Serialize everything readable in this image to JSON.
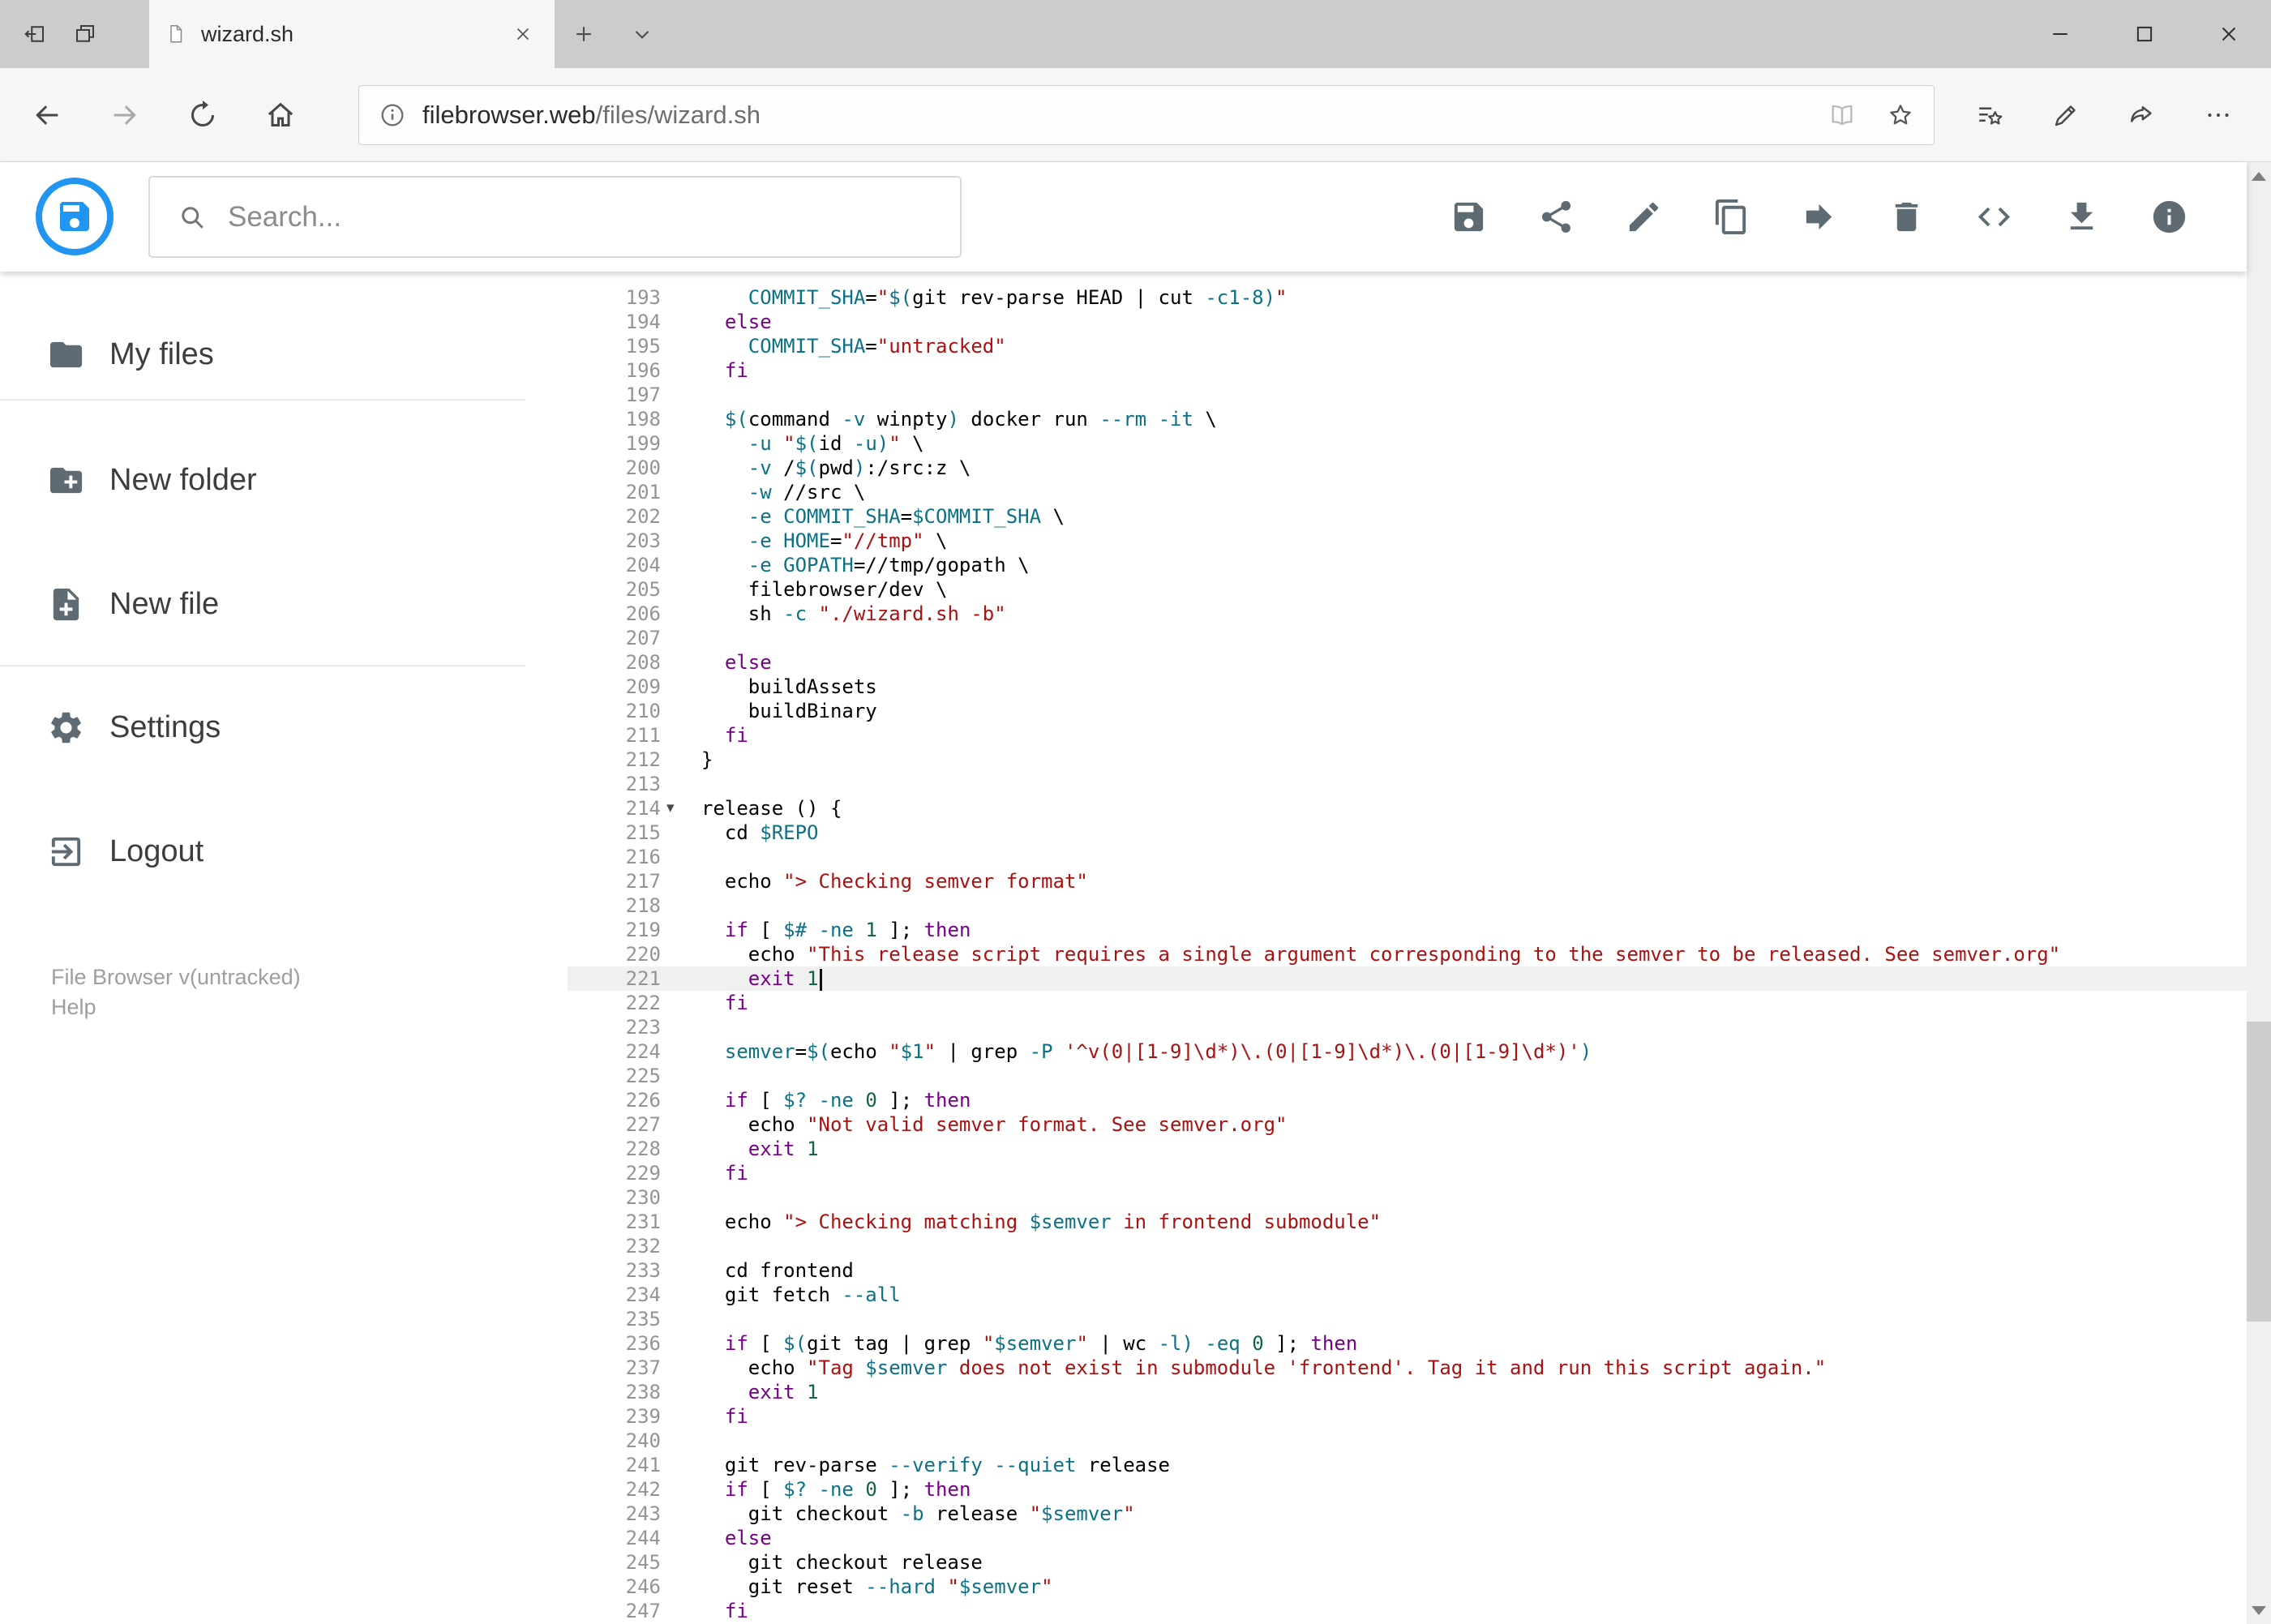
{
  "colors": {
    "accent": "#2095f2",
    "icon-gray": "#5f6b73",
    "tok-p": "#000000",
    "tok-k": "#770088",
    "tok-v": "#0b7285",
    "tok-s": "#aa1111",
    "tok-n": "#116644",
    "active-line": "#f0f0f0"
  },
  "browser": {
    "tab_title": "wizard.sh",
    "url": {
      "host": "filebrowser.web",
      "path": "/files/wizard.sh"
    }
  },
  "header": {
    "search_placeholder": "Search...",
    "toolbar": [
      {
        "name": "save",
        "icon": "save"
      },
      {
        "name": "share",
        "icon": "share"
      },
      {
        "name": "rename",
        "icon": "edit"
      },
      {
        "name": "copy",
        "icon": "copy"
      },
      {
        "name": "move",
        "icon": "move"
      },
      {
        "name": "delete",
        "icon": "delete"
      },
      {
        "name": "raw",
        "icon": "code"
      },
      {
        "name": "download",
        "icon": "download"
      },
      {
        "name": "info",
        "icon": "info"
      }
    ]
  },
  "sidebar": {
    "items": [
      {
        "label": "My files",
        "icon": "folder"
      },
      {
        "label": "New folder",
        "icon": "create-new-folder"
      },
      {
        "label": "New file",
        "icon": "note-add"
      },
      {
        "label": "Settings",
        "icon": "settings"
      },
      {
        "label": "Logout",
        "icon": "logout"
      }
    ],
    "footer": {
      "version": "File Browser v(untracked)",
      "help": "Help"
    }
  },
  "editor": {
    "active_line": 221,
    "lines": [
      {
        "n": 193,
        "segs": [
          [
            "    ",
            "p"
          ],
          [
            "COMMIT_SHA",
            "v"
          ],
          [
            "=",
            "p"
          ],
          [
            "\"",
            "s"
          ],
          [
            "$(",
            "v"
          ],
          [
            "git rev-parse HEAD | cut ",
            "p"
          ],
          [
            "-c1-8",
            "v"
          ],
          [
            ")",
            "v"
          ],
          [
            "\"",
            "s"
          ]
        ]
      },
      {
        "n": 194,
        "segs": [
          [
            "  ",
            "p"
          ],
          [
            "else",
            "k"
          ]
        ]
      },
      {
        "n": 195,
        "segs": [
          [
            "    ",
            "p"
          ],
          [
            "COMMIT_SHA",
            "v"
          ],
          [
            "=",
            "p"
          ],
          [
            "\"untracked\"",
            "s"
          ]
        ]
      },
      {
        "n": 196,
        "segs": [
          [
            "  ",
            "p"
          ],
          [
            "fi",
            "k"
          ]
        ]
      },
      {
        "n": 197,
        "segs": []
      },
      {
        "n": 198,
        "segs": [
          [
            "  ",
            "p"
          ],
          [
            "$(",
            "v"
          ],
          [
            "command ",
            "p"
          ],
          [
            "-v",
            "v"
          ],
          [
            " winpty",
            "p"
          ],
          [
            ")",
            "v"
          ],
          [
            " docker run ",
            "p"
          ],
          [
            "--rm",
            "v"
          ],
          [
            " ",
            "p"
          ],
          [
            "-it",
            "v"
          ],
          [
            " \\",
            "p"
          ]
        ]
      },
      {
        "n": 199,
        "segs": [
          [
            "    ",
            "p"
          ],
          [
            "-u",
            "v"
          ],
          [
            " ",
            "p"
          ],
          [
            "\"",
            "s"
          ],
          [
            "$(",
            "v"
          ],
          [
            "id ",
            "p"
          ],
          [
            "-u",
            "v"
          ],
          [
            ")",
            "v"
          ],
          [
            "\"",
            "s"
          ],
          [
            " \\",
            "p"
          ]
        ]
      },
      {
        "n": 200,
        "segs": [
          [
            "    ",
            "p"
          ],
          [
            "-v",
            "v"
          ],
          [
            " /",
            "p"
          ],
          [
            "$(",
            "v"
          ],
          [
            "pwd",
            "p"
          ],
          [
            ")",
            "v"
          ],
          [
            ":/src:z \\",
            "p"
          ]
        ]
      },
      {
        "n": 201,
        "segs": [
          [
            "    ",
            "p"
          ],
          [
            "-w",
            "v"
          ],
          [
            " //src \\",
            "p"
          ]
        ]
      },
      {
        "n": 202,
        "segs": [
          [
            "    ",
            "p"
          ],
          [
            "-e",
            "v"
          ],
          [
            " ",
            "p"
          ],
          [
            "COMMIT_SHA",
            "v"
          ],
          [
            "=",
            "p"
          ],
          [
            "$COMMIT_SHA",
            "v"
          ],
          [
            " \\",
            "p"
          ]
        ]
      },
      {
        "n": 203,
        "segs": [
          [
            "    ",
            "p"
          ],
          [
            "-e",
            "v"
          ],
          [
            " ",
            "p"
          ],
          [
            "HOME",
            "v"
          ],
          [
            "=",
            "p"
          ],
          [
            "\"//tmp\"",
            "s"
          ],
          [
            " \\",
            "p"
          ]
        ]
      },
      {
        "n": 204,
        "segs": [
          [
            "    ",
            "p"
          ],
          [
            "-e",
            "v"
          ],
          [
            " ",
            "p"
          ],
          [
            "GOPATH",
            "v"
          ],
          [
            "=",
            "p"
          ],
          [
            "//tmp/gopath \\",
            "p"
          ]
        ]
      },
      {
        "n": 205,
        "segs": [
          [
            "    filebrowser/dev \\",
            "p"
          ]
        ]
      },
      {
        "n": 206,
        "segs": [
          [
            "    sh ",
            "p"
          ],
          [
            "-c",
            "v"
          ],
          [
            " ",
            "p"
          ],
          [
            "\"./wizard.sh -b\"",
            "s"
          ]
        ]
      },
      {
        "n": 207,
        "segs": []
      },
      {
        "n": 208,
        "segs": [
          [
            "  ",
            "p"
          ],
          [
            "else",
            "k"
          ]
        ]
      },
      {
        "n": 209,
        "segs": [
          [
            "    buildAssets",
            "p"
          ]
        ]
      },
      {
        "n": 210,
        "segs": [
          [
            "    buildBinary",
            "p"
          ]
        ]
      },
      {
        "n": 211,
        "segs": [
          [
            "  ",
            "p"
          ],
          [
            "fi",
            "k"
          ]
        ]
      },
      {
        "n": 212,
        "segs": [
          [
            "}",
            "p"
          ]
        ]
      },
      {
        "n": 213,
        "segs": []
      },
      {
        "n": 214,
        "fold": true,
        "segs": [
          [
            "release () {",
            "p"
          ]
        ]
      },
      {
        "n": 215,
        "segs": [
          [
            "  cd ",
            "p"
          ],
          [
            "$REPO",
            "v"
          ]
        ]
      },
      {
        "n": 216,
        "segs": []
      },
      {
        "n": 217,
        "segs": [
          [
            "  echo ",
            "p"
          ],
          [
            "\"> Checking semver format\"",
            "s"
          ]
        ]
      },
      {
        "n": 218,
        "segs": []
      },
      {
        "n": 219,
        "segs": [
          [
            "  ",
            "p"
          ],
          [
            "if",
            "k"
          ],
          [
            " [ ",
            "p"
          ],
          [
            "$#",
            "v"
          ],
          [
            " ",
            "p"
          ],
          [
            "-ne",
            "v"
          ],
          [
            " ",
            "p"
          ],
          [
            "1",
            "n"
          ],
          [
            " ]; ",
            "p"
          ],
          [
            "then",
            "k"
          ]
        ]
      },
      {
        "n": 220,
        "segs": [
          [
            "    echo ",
            "p"
          ],
          [
            "\"This release script requires a single argument corresponding to the semver to be released. See semver.org\"",
            "s"
          ]
        ]
      },
      {
        "n": 221,
        "cursor": true,
        "segs": [
          [
            "    ",
            "p"
          ],
          [
            "exit",
            "k"
          ],
          [
            " ",
            "p"
          ],
          [
            "1",
            "n"
          ]
        ]
      },
      {
        "n": 222,
        "segs": [
          [
            "  ",
            "p"
          ],
          [
            "fi",
            "k"
          ]
        ]
      },
      {
        "n": 223,
        "segs": []
      },
      {
        "n": 224,
        "segs": [
          [
            "  ",
            "p"
          ],
          [
            "semver",
            "v"
          ],
          [
            "=",
            "p"
          ],
          [
            "$(",
            "v"
          ],
          [
            "echo ",
            "p"
          ],
          [
            "\"",
            "s"
          ],
          [
            "$1",
            "v"
          ],
          [
            "\"",
            "s"
          ],
          [
            " | grep ",
            "p"
          ],
          [
            "-P",
            "v"
          ],
          [
            " ",
            "p"
          ],
          [
            "'^v(0|[1-9]\\d*)\\.(0|[1-9]\\d*)\\.(0|[1-9]\\d*)'",
            "s"
          ],
          [
            ")",
            "v"
          ]
        ]
      },
      {
        "n": 225,
        "segs": []
      },
      {
        "n": 226,
        "segs": [
          [
            "  ",
            "p"
          ],
          [
            "if",
            "k"
          ],
          [
            " [ ",
            "p"
          ],
          [
            "$?",
            "v"
          ],
          [
            " ",
            "p"
          ],
          [
            "-ne",
            "v"
          ],
          [
            " ",
            "p"
          ],
          [
            "0",
            "n"
          ],
          [
            " ]; ",
            "p"
          ],
          [
            "then",
            "k"
          ]
        ]
      },
      {
        "n": 227,
        "segs": [
          [
            "    echo ",
            "p"
          ],
          [
            "\"Not valid semver format. See semver.org\"",
            "s"
          ]
        ]
      },
      {
        "n": 228,
        "segs": [
          [
            "    ",
            "p"
          ],
          [
            "exit",
            "k"
          ],
          [
            " ",
            "p"
          ],
          [
            "1",
            "n"
          ]
        ]
      },
      {
        "n": 229,
        "segs": [
          [
            "  ",
            "p"
          ],
          [
            "fi",
            "k"
          ]
        ]
      },
      {
        "n": 230,
        "segs": []
      },
      {
        "n": 231,
        "segs": [
          [
            "  echo ",
            "p"
          ],
          [
            "\"> Checking matching ",
            "s"
          ],
          [
            "$semver",
            "v"
          ],
          [
            " in frontend submodule\"",
            "s"
          ]
        ]
      },
      {
        "n": 232,
        "segs": []
      },
      {
        "n": 233,
        "segs": [
          [
            "  cd frontend",
            "p"
          ]
        ]
      },
      {
        "n": 234,
        "segs": [
          [
            "  git fetch ",
            "p"
          ],
          [
            "--all",
            "v"
          ]
        ]
      },
      {
        "n": 235,
        "segs": []
      },
      {
        "n": 236,
        "segs": [
          [
            "  ",
            "p"
          ],
          [
            "if",
            "k"
          ],
          [
            " [ ",
            "p"
          ],
          [
            "$(",
            "v"
          ],
          [
            "git tag | grep ",
            "p"
          ],
          [
            "\"",
            "s"
          ],
          [
            "$semver",
            "v"
          ],
          [
            "\"",
            "s"
          ],
          [
            " | wc ",
            "p"
          ],
          [
            "-l",
            "v"
          ],
          [
            ")",
            "v"
          ],
          [
            " ",
            "p"
          ],
          [
            "-eq",
            "v"
          ],
          [
            " ",
            "p"
          ],
          [
            "0",
            "n"
          ],
          [
            " ]; ",
            "p"
          ],
          [
            "then",
            "k"
          ]
        ]
      },
      {
        "n": 237,
        "segs": [
          [
            "    echo ",
            "p"
          ],
          [
            "\"Tag ",
            "s"
          ],
          [
            "$semver",
            "v"
          ],
          [
            " does not exist in submodule 'frontend'. Tag it and run this script again.\"",
            "s"
          ]
        ]
      },
      {
        "n": 238,
        "segs": [
          [
            "    ",
            "p"
          ],
          [
            "exit",
            "k"
          ],
          [
            " ",
            "p"
          ],
          [
            "1",
            "n"
          ]
        ]
      },
      {
        "n": 239,
        "segs": [
          [
            "  ",
            "p"
          ],
          [
            "fi",
            "k"
          ]
        ]
      },
      {
        "n": 240,
        "segs": []
      },
      {
        "n": 241,
        "segs": [
          [
            "  git rev-parse ",
            "p"
          ],
          [
            "--verify",
            "v"
          ],
          [
            " ",
            "p"
          ],
          [
            "--quiet",
            "v"
          ],
          [
            " release",
            "p"
          ]
        ]
      },
      {
        "n": 242,
        "segs": [
          [
            "  ",
            "p"
          ],
          [
            "if",
            "k"
          ],
          [
            " [ ",
            "p"
          ],
          [
            "$?",
            "v"
          ],
          [
            " ",
            "p"
          ],
          [
            "-ne",
            "v"
          ],
          [
            " ",
            "p"
          ],
          [
            "0",
            "n"
          ],
          [
            " ]; ",
            "p"
          ],
          [
            "then",
            "k"
          ]
        ]
      },
      {
        "n": 243,
        "segs": [
          [
            "    git checkout ",
            "p"
          ],
          [
            "-b",
            "v"
          ],
          [
            " release ",
            "p"
          ],
          [
            "\"",
            "s"
          ],
          [
            "$semver",
            "v"
          ],
          [
            "\"",
            "s"
          ]
        ]
      },
      {
        "n": 244,
        "segs": [
          [
            "  ",
            "p"
          ],
          [
            "else",
            "k"
          ]
        ]
      },
      {
        "n": 245,
        "segs": [
          [
            "    git checkout release",
            "p"
          ]
        ]
      },
      {
        "n": 246,
        "segs": [
          [
            "    git reset ",
            "p"
          ],
          [
            "--hard",
            "v"
          ],
          [
            " ",
            "p"
          ],
          [
            "\"",
            "s"
          ],
          [
            "$semver",
            "v"
          ],
          [
            "\"",
            "s"
          ]
        ]
      },
      {
        "n": 247,
        "segs": [
          [
            "  ",
            "p"
          ],
          [
            "fi",
            "k"
          ]
        ]
      }
    ]
  }
}
